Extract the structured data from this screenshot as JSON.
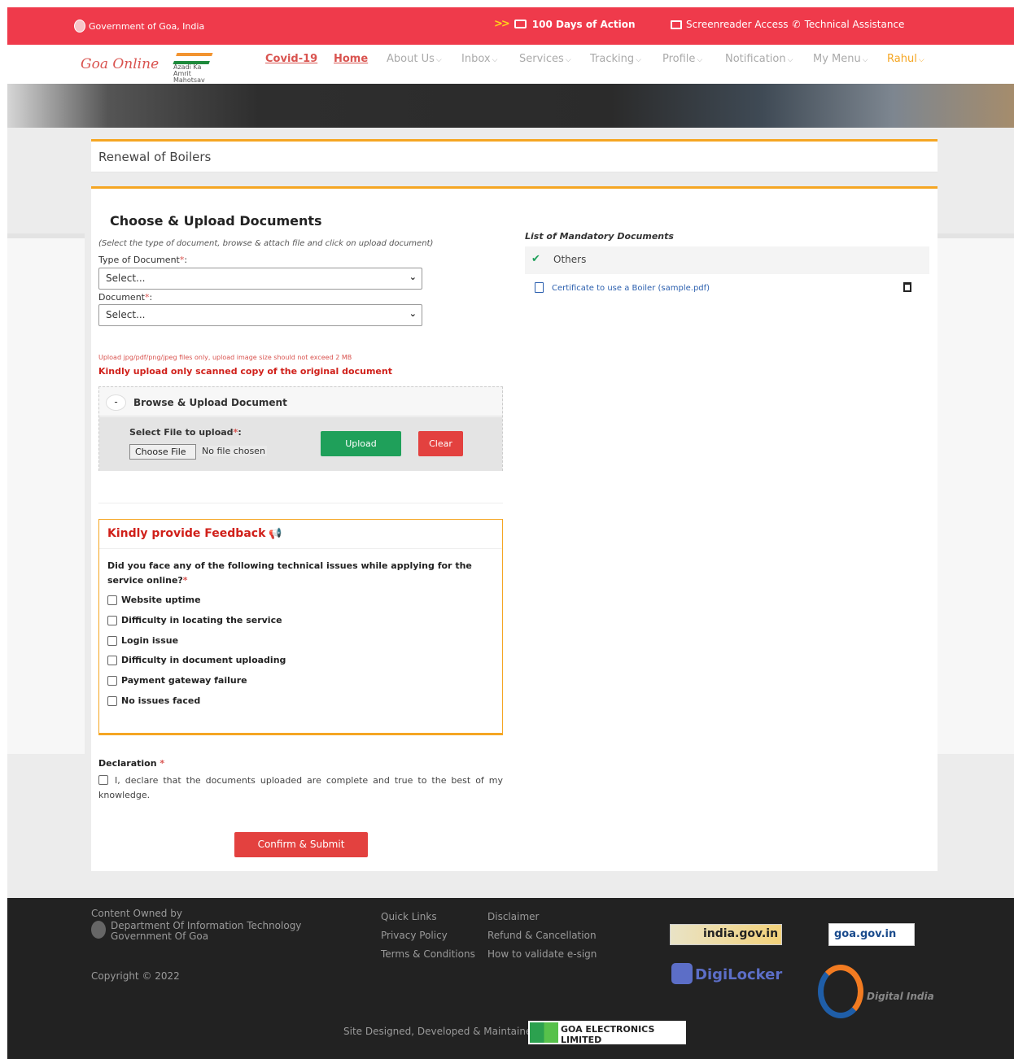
{
  "topbar": {
    "gov_text": "Government of Goa, India",
    "days_arrows": ">>",
    "days_text": "100 Days of Action",
    "screenreader": "Screenreader Access",
    "technical": "Technical Assistance",
    "color": "#ef3a4b"
  },
  "nav": {
    "logo": "Goa Online",
    "azadi_l1": "Azadi Ka",
    "azadi_l2": "Amrit Mahotsav",
    "items": [
      {
        "label": "Covid-19"
      },
      {
        "label": "Home"
      },
      {
        "label": "About Us"
      },
      {
        "label": "Inbox"
      },
      {
        "label": "Services"
      },
      {
        "label": "Tracking"
      },
      {
        "label": "Profile"
      },
      {
        "label": "Notification"
      },
      {
        "label": "My Menu"
      },
      {
        "label": "Rahul"
      }
    ]
  },
  "page": {
    "title": "Renewal of Boilers"
  },
  "upload": {
    "heading": "Choose & Upload Documents",
    "hint": "(Select the type of document, browse & attach file and click on upload document)",
    "type_label": "Type of Document",
    "type_value": "Select...",
    "doc_label": "Document",
    "doc_value": "Select...",
    "note_small": "Upload jpg/pdf/png/jpeg files only, upload image size should not exceed 2 MB",
    "note_bold": "Kindly upload only scanned copy of the original document",
    "browse_title": "Browse & Upload Document",
    "collapse": "-",
    "select_file_label": "Select File to upload",
    "choose_file": "Choose File",
    "no_file": "No file chosen",
    "upload_btn": "Upload",
    "clear_btn": "Clear",
    "req": "*",
    "colon": ":"
  },
  "feedback": {
    "title": "Kindly provide Feedback",
    "question": "Did you face any of the following technical issues while applying for the service online?",
    "options": [
      "Website uptime",
      "Difficulty in locating the service",
      "Login issue",
      "Difficulty in document uploading",
      "Payment gateway failure",
      "No issues faced"
    ]
  },
  "declaration": {
    "title": "Declaration",
    "text": "I, declare that the documents uploaded are complete and true to the best of my knowledge.",
    "submit": "Confirm & Submit"
  },
  "mandatory": {
    "title": "List of Mandatory Documents",
    "group": "Others",
    "doc": "Certificate to use a Boiler (sample.pdf)"
  },
  "footer": {
    "content_owned": "Content Owned by",
    "dept_l1": "Department Of Information Technology",
    "dept_l2": "Government Of Goa",
    "copyright": "Copyright © 2022",
    "quick_links": [
      "Quick Links",
      "Privacy Policy",
      "Terms & Conditions"
    ],
    "disclaimer_links": [
      "Disclaimer",
      "Refund & Cancellation",
      "How to validate e-sign"
    ],
    "india_gov": "india.gov.in",
    "goa_gov": "goa.gov.in",
    "digilocker": "DigiLocker",
    "digital_india": "Digital India",
    "site_text": "Site Designed, Developed & Maintained by",
    "gel": "GOA ELECTRONICS LIMITED"
  }
}
